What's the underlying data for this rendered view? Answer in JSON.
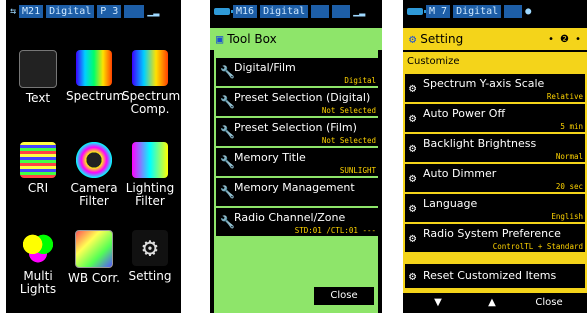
{
  "screen1": {
    "status": {
      "memory": "M21",
      "mode": "Digital",
      "page": "P 3"
    },
    "tiles": [
      {
        "label": "Text"
      },
      {
        "label": "Spectrum"
      },
      {
        "label": "Spectrum\nComp."
      },
      {
        "label": "CRI"
      },
      {
        "label": "Camera\nFilter"
      },
      {
        "label": "Lighting\nFilter"
      },
      {
        "label": "Multi\nLights"
      },
      {
        "label": "WB Corr."
      },
      {
        "label": "Setting"
      }
    ]
  },
  "screen2": {
    "status": {
      "memory": "M16",
      "mode": "Digital"
    },
    "title": "Tool Box",
    "items": [
      {
        "label": "Digital/Film",
        "value": "Digital"
      },
      {
        "label": "Preset Selection (Digital)",
        "value": "Not Selected"
      },
      {
        "label": "Preset Selection (Film)",
        "value": "Not Selected"
      },
      {
        "label": "Memory Title",
        "value": "SUNLIGHT"
      },
      {
        "label": "Memory Management",
        "value": ""
      },
      {
        "label": "Radio Channel/Zone",
        "value": "STD:01 /CTL:01 ---"
      }
    ],
    "close_label": "Close"
  },
  "screen3": {
    "status": {
      "memory": "M 7",
      "mode": "Digital"
    },
    "title": "Setting",
    "section": "Customize",
    "items": [
      {
        "label": "Spectrum Y-axis Scale",
        "value": "Relative"
      },
      {
        "label": "Auto Power Off",
        "value": "5 min"
      },
      {
        "label": "Backlight Brightness",
        "value": "Normal"
      },
      {
        "label": "Auto Dimmer",
        "value": "20 sec"
      },
      {
        "label": "Language",
        "value": "English"
      },
      {
        "label": "Radio System Preference",
        "value": "ControlTL + Standard"
      }
    ],
    "reset_label": "Reset Customized Items",
    "close_label": "Close"
  }
}
